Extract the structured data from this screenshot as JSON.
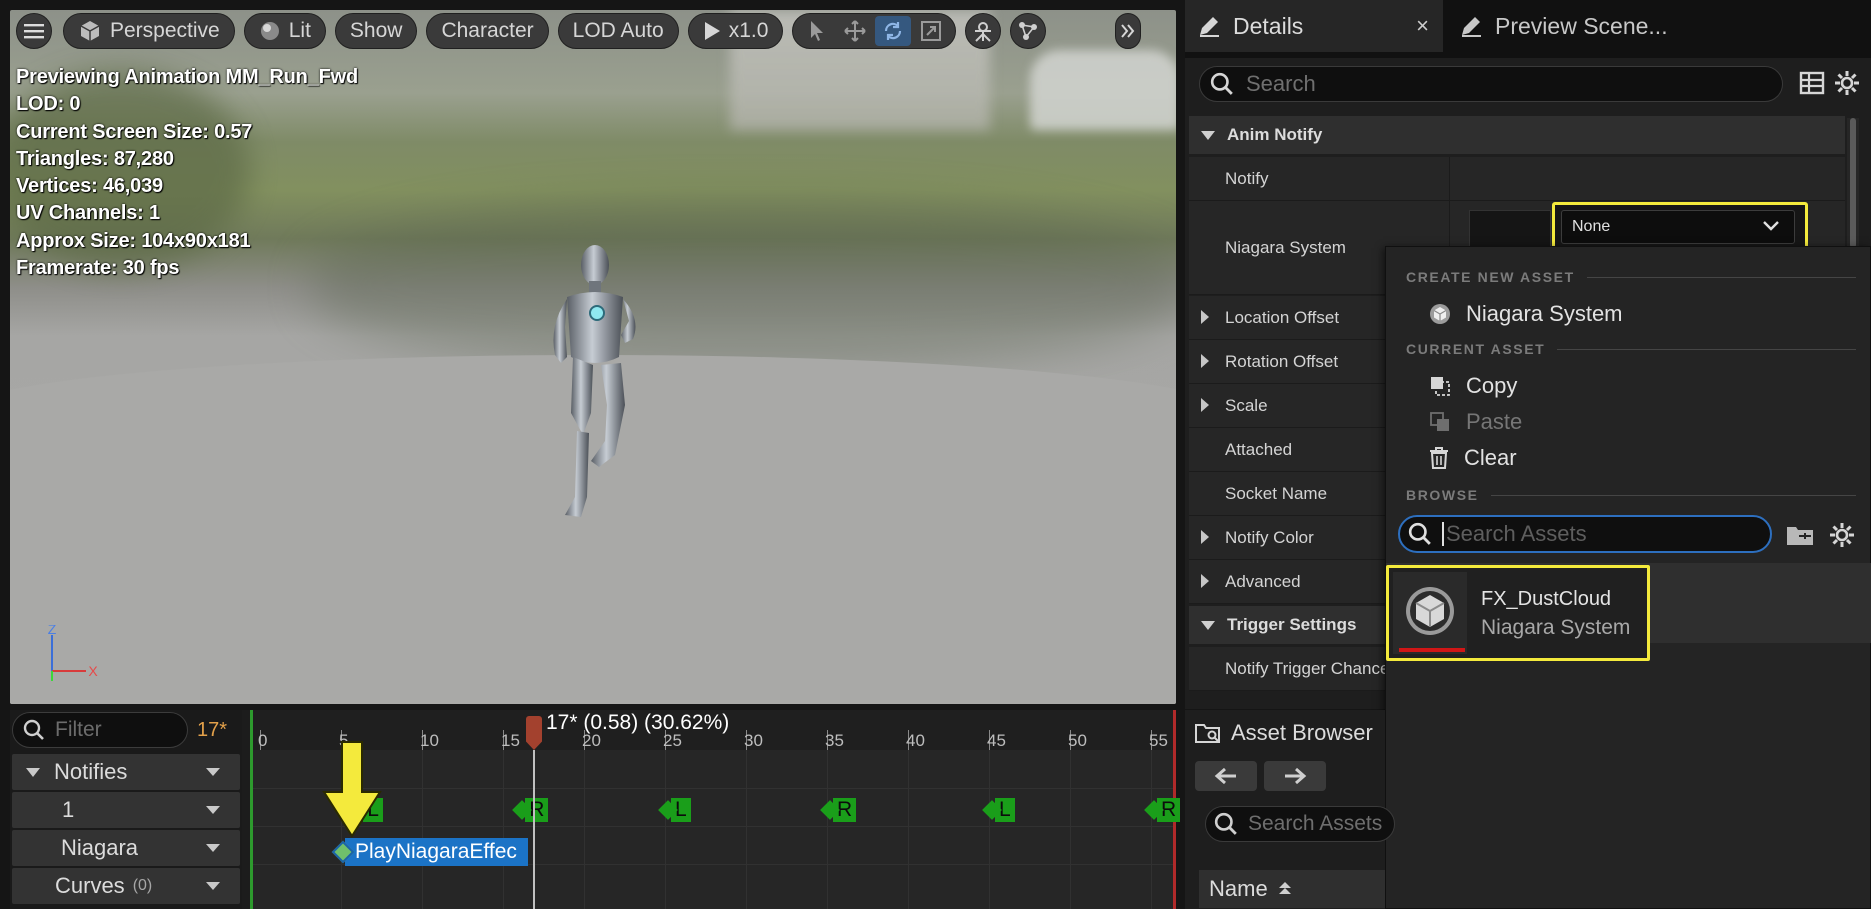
{
  "viewport": {
    "toolbar": {
      "menu_icon": "hamburger-icon",
      "perspective": "Perspective",
      "lit": "Lit",
      "show": "Show",
      "character": "Character",
      "lod": "LOD Auto",
      "speed": "x1.0",
      "expand_icon": "double-chevron-right-icon"
    },
    "stats": [
      "Previewing Animation MM_Run_Fwd",
      "LOD: 0",
      "Current Screen Size: 0.57",
      "Triangles: 87,280",
      "Vertices: 46,039",
      "UV Channels: 1",
      "Approx Size: 104x90x181",
      "Framerate: 30 fps"
    ],
    "axis": {
      "z": "Z",
      "x": "X"
    }
  },
  "timeline": {
    "filter_placeholder": "Filter",
    "frame_count": "17*",
    "tracks": [
      {
        "label": "Notifies",
        "kind": "header"
      },
      {
        "label": "1",
        "kind": "sub"
      },
      {
        "label": "Niagara",
        "kind": "sub"
      },
      {
        "label": "Curves",
        "count": "(0)",
        "kind": "header"
      }
    ],
    "ruler_labels": [
      "0",
      "5",
      "10",
      "15",
      "20",
      "25",
      "30",
      "35",
      "40",
      "45",
      "50",
      "55"
    ],
    "playhead_label": "17* (0.58) (30.62%)",
    "foot_markers": [
      "L",
      "R",
      "L",
      "R",
      "L",
      "R"
    ],
    "notify_label": "PlayNiagaraEffec"
  },
  "details": {
    "tab_details": "Details",
    "tab_close": "×",
    "tab_preview": "Preview Scene...",
    "search_placeholder": "Search",
    "sections": {
      "anim_notify": "Anim Notify",
      "trigger_settings": "Trigger Settings"
    },
    "props": {
      "notify": "Notify",
      "niagara_system": "Niagara System",
      "location_offset": "Location Offset",
      "rotation_offset": "Rotation Offset",
      "scale": "Scale",
      "attached": "Attached",
      "socket_name": "Socket Name",
      "notify_color": "Notify Color",
      "advanced": "Advanced",
      "notify_trigger_chance": "Notify Trigger Chance"
    },
    "combo_value": "None"
  },
  "popup": {
    "create_new_asset": "CREATE NEW ASSET",
    "niagara_system": "Niagara System",
    "current_asset": "CURRENT ASSET",
    "copy": "Copy",
    "paste": "Paste",
    "clear": "Clear",
    "browse": "BROWSE",
    "search_placeholder": "Search Assets",
    "asset_name": "FX_DustCloud",
    "asset_type": "Niagara System"
  },
  "asset_browser": {
    "title": "Asset Browser",
    "search_placeholder": "Search Assets",
    "name_column": "Name"
  },
  "colors": {
    "highlight": "#f4ea3c",
    "foot_marker": "#1a9e1a",
    "notify": "#1b73c6",
    "playhead": "#a3412e",
    "frame_count": "#e2a04a"
  }
}
